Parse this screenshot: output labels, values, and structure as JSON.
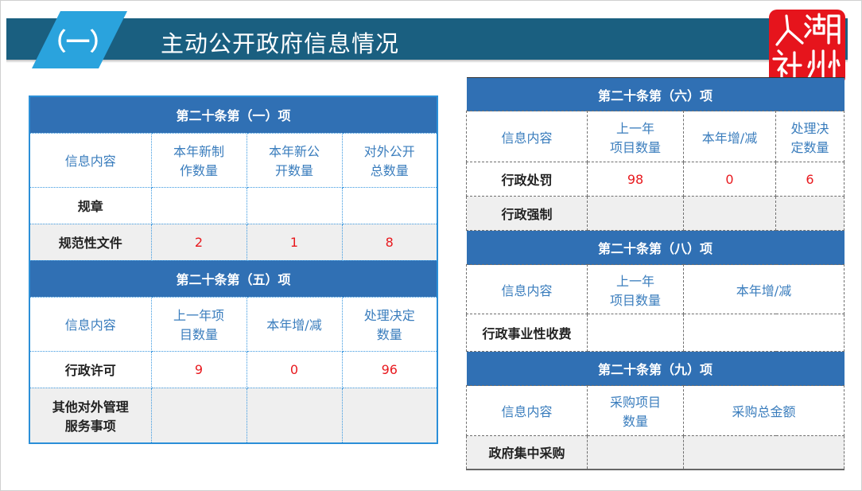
{
  "title": {
    "number": "（一）",
    "text": "主动公开政府信息情况"
  },
  "logo": {
    "chars": [
      "人",
      "湖",
      "社",
      "州"
    ],
    "icon": "renshe-huzhou-seal-logo"
  },
  "left_table": {
    "section1": {
      "header": "第二十条第（一）项",
      "columns": [
        "信息内容",
        "本年新制\n作数量",
        "本年新公\n开数量",
        "对外公开\n总数量"
      ],
      "rows": [
        {
          "label": "规章",
          "values": [
            "",
            "",
            ""
          ]
        },
        {
          "label": "规范性文件",
          "values": [
            "2",
            "1",
            "8"
          ]
        }
      ]
    },
    "section2": {
      "header": "第二十条第（五）项",
      "columns": [
        "信息内容",
        "上一年项\n目数量",
        "本年增/减",
        "处理决定\n数量"
      ],
      "rows": [
        {
          "label": "行政许可",
          "values": [
            "9",
            "0",
            "96"
          ]
        },
        {
          "label": "其他对外管理\n服务事项",
          "values": [
            "",
            "",
            ""
          ]
        }
      ]
    }
  },
  "right_table": {
    "section1": {
      "header": "第二十条第（六）项",
      "columns": [
        "信息内容",
        "上一年\n项目数量",
        "本年增/减",
        "处理决\n定数量"
      ],
      "rows": [
        {
          "label": "行政处罚",
          "values": [
            "98",
            "0",
            "6"
          ]
        },
        {
          "label": "行政强制",
          "values": [
            "",
            "",
            ""
          ]
        }
      ]
    },
    "section2": {
      "header": "第二十条第（八）项",
      "columns": [
        "信息内容",
        "上一年\n项目数量",
        "本年增/减"
      ],
      "rows": [
        {
          "label": "行政事业性收费",
          "values": [
            "",
            ""
          ]
        }
      ]
    },
    "section3": {
      "header": "第二十条第（九）项",
      "columns": [
        "信息内容",
        "采购项目\n数量",
        "采购总金额"
      ],
      "rows": [
        {
          "label": "政府集中采购",
          "values": [
            "",
            ""
          ]
        }
      ]
    }
  },
  "colors": {
    "title_bar": "#1a5f80",
    "title_tab": "#2aa3dd",
    "header_blue": "#3070b4",
    "column_text": "#3a7dbd",
    "value_red": "#e8191e",
    "logo_red": "#e6141c"
  }
}
